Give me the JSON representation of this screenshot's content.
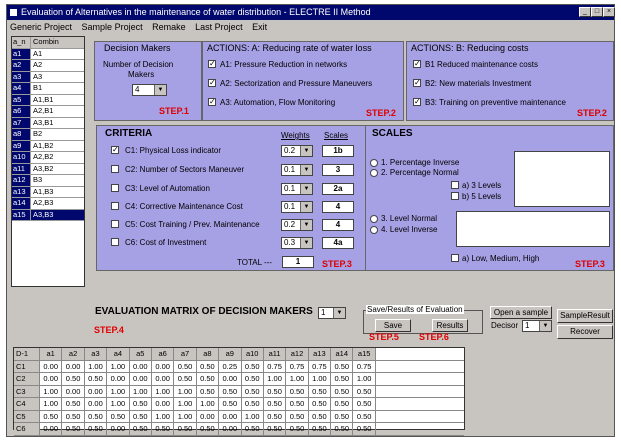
{
  "window": {
    "title": "Evaluation of Alternatives in the maintenance of water distribution - ELECTRE II Method"
  },
  "menu": [
    "Generic Project",
    "Sample Project",
    "Remake",
    "Last Project",
    "Exit"
  ],
  "alternatives": {
    "header": [
      "a_n",
      "Combin"
    ],
    "rows": [
      [
        "a1",
        "A1"
      ],
      [
        "a2",
        "A2"
      ],
      [
        "a3",
        "A3"
      ],
      [
        "a4",
        "B1"
      ],
      [
        "a5",
        "A1,B1"
      ],
      [
        "a6",
        "A2,B1"
      ],
      [
        "a7",
        "A3,B1"
      ],
      [
        "a8",
        "B2"
      ],
      [
        "a9",
        "A1,B2"
      ],
      [
        "a10",
        "A2,B2"
      ],
      [
        "a11",
        "A3,B2"
      ],
      [
        "a12",
        "B3"
      ],
      [
        "a13",
        "A1,B3"
      ],
      [
        "a14",
        "A2,B3"
      ],
      [
        "a15",
        "A3,B3"
      ]
    ]
  },
  "decision_makers": {
    "title": "Decision Makers",
    "label_line1": "Number of Decision",
    "label_line2": "Makers",
    "value": "4",
    "step": "STEP.1"
  },
  "actions_a": {
    "title": "ACTIONS: A: Reducing rate of water loss",
    "items": [
      {
        "label": "A1: Pressure Reduction in networks",
        "checked": true
      },
      {
        "label": "A2: Sectorization and Pressure Maneuvers",
        "checked": true
      },
      {
        "label": "A3: Automation, Flow Monitoring",
        "checked": true
      }
    ],
    "step": "STEP.2"
  },
  "actions_b": {
    "title": "ACTIONS: B: Reducing costs",
    "items": [
      {
        "label": "B1 Reduced maintenance costs",
        "checked": true
      },
      {
        "label": "B2: New materials Investment",
        "checked": true
      },
      {
        "label": "B3: Training on preventive maintenance",
        "checked": true
      }
    ],
    "step": "STEP.2"
  },
  "criteria": {
    "title": "CRITERIA",
    "weights_header": "Weights",
    "scales_header": "Scales",
    "items": [
      {
        "label": "C1: Physical Loss indicator",
        "checked": true,
        "weight": "0.2",
        "scale": "1b"
      },
      {
        "label": "C2: Number of Sectors Maneuver",
        "checked": false,
        "weight": "0.1",
        "scale": "3"
      },
      {
        "label": "C3: Level of Automation",
        "checked": false,
        "weight": "0.1",
        "scale": "2a"
      },
      {
        "label": "C4: Corrective Maintenance Cost",
        "checked": false,
        "weight": "0.1",
        "scale": "4"
      },
      {
        "label": "C5: Cost Training / Prev. Maintenance",
        "checked": false,
        "weight": "0.2",
        "scale": "4"
      },
      {
        "label": "C6: Cost of Investment",
        "checked": false,
        "weight": "0.3",
        "scale": "4a"
      }
    ],
    "total_label": "TOTAL ---",
    "total_value": "1",
    "step": "STEP.3"
  },
  "scales": {
    "title": "SCALES",
    "opt1": "1. Percentage Inverse",
    "opt2": "2. Percentage Normal",
    "sub_a": "a) 3 Levels",
    "sub_b": "b) 5 Levels",
    "opt3": "3. Level Normal",
    "opt4": "4. Level Inverse",
    "sub_c": "a) Low, Medium, High",
    "step": "STEP.3"
  },
  "evaluation": {
    "title": "EVALUATION MATRIX OF DECISION MAKERS",
    "dm_select": "1",
    "step4": "STEP.4",
    "save_group": "Save/Results of Evaluation",
    "save_btn": "Save",
    "results_btn": "Results",
    "step5": "STEP.5",
    "step6": "STEP.6",
    "open_sample_btn": "Open a sample",
    "decisor_label": "Decisor",
    "decisor_value": "1",
    "sample_result_btn": "SampleResult",
    "recover_btn": "Recover"
  },
  "matrix": {
    "columns": [
      "D-1",
      "a1",
      "a2",
      "a3",
      "a4",
      "a5",
      "a6",
      "a7",
      "a8",
      "a9",
      "a10",
      "a11",
      "a12",
      "a13",
      "a14",
      "a15"
    ],
    "rows": [
      [
        "C1",
        "0.00",
        "0.00",
        "1.00",
        "1.00",
        "0.00",
        "0.00",
        "0.50",
        "0.50",
        "0.25",
        "0.50",
        "0.75",
        "0.75",
        "0.75",
        "0.50",
        "0.75"
      ],
      [
        "C2",
        "0.00",
        "0.50",
        "0.50",
        "0.00",
        "0.00",
        "0.00",
        "0.50",
        "0.50",
        "0.00",
        "0.50",
        "1.00",
        "1.00",
        "1.00",
        "0.50",
        "1.00"
      ],
      [
        "C3",
        "1.00",
        "0.00",
        "0.00",
        "1.00",
        "1.00",
        "1.00",
        "1.00",
        "0.50",
        "0.50",
        "0.50",
        "0.50",
        "0.50",
        "0.50",
        "0.50",
        "0.50"
      ],
      [
        "C4",
        "1.00",
        "0.50",
        "0.00",
        "1.00",
        "0.50",
        "0.00",
        "1.00",
        "1.00",
        "0.50",
        "0.50",
        "0.50",
        "0.50",
        "0.50",
        "0.50",
        "0.50"
      ],
      [
        "C5",
        "0.50",
        "0.50",
        "0.50",
        "0.50",
        "0.50",
        "1.00",
        "1.00",
        "0.00",
        "0.00",
        "1.00",
        "0.50",
        "0.50",
        "0.50",
        "0.50",
        "0.50"
      ],
      [
        "C6",
        "0.00",
        "0.50",
        "0.50",
        "0.00",
        "0.50",
        "0.50",
        "0.50",
        "0.50",
        "0.00",
        "0.50",
        "0.50",
        "0.50",
        "0.50",
        "0.50",
        "0.50"
      ]
    ]
  },
  "colors": {
    "panel": "#a6a0e4",
    "titlebar": "#00086e",
    "step": "#e00000",
    "window_bg": "#c8c4c0"
  }
}
